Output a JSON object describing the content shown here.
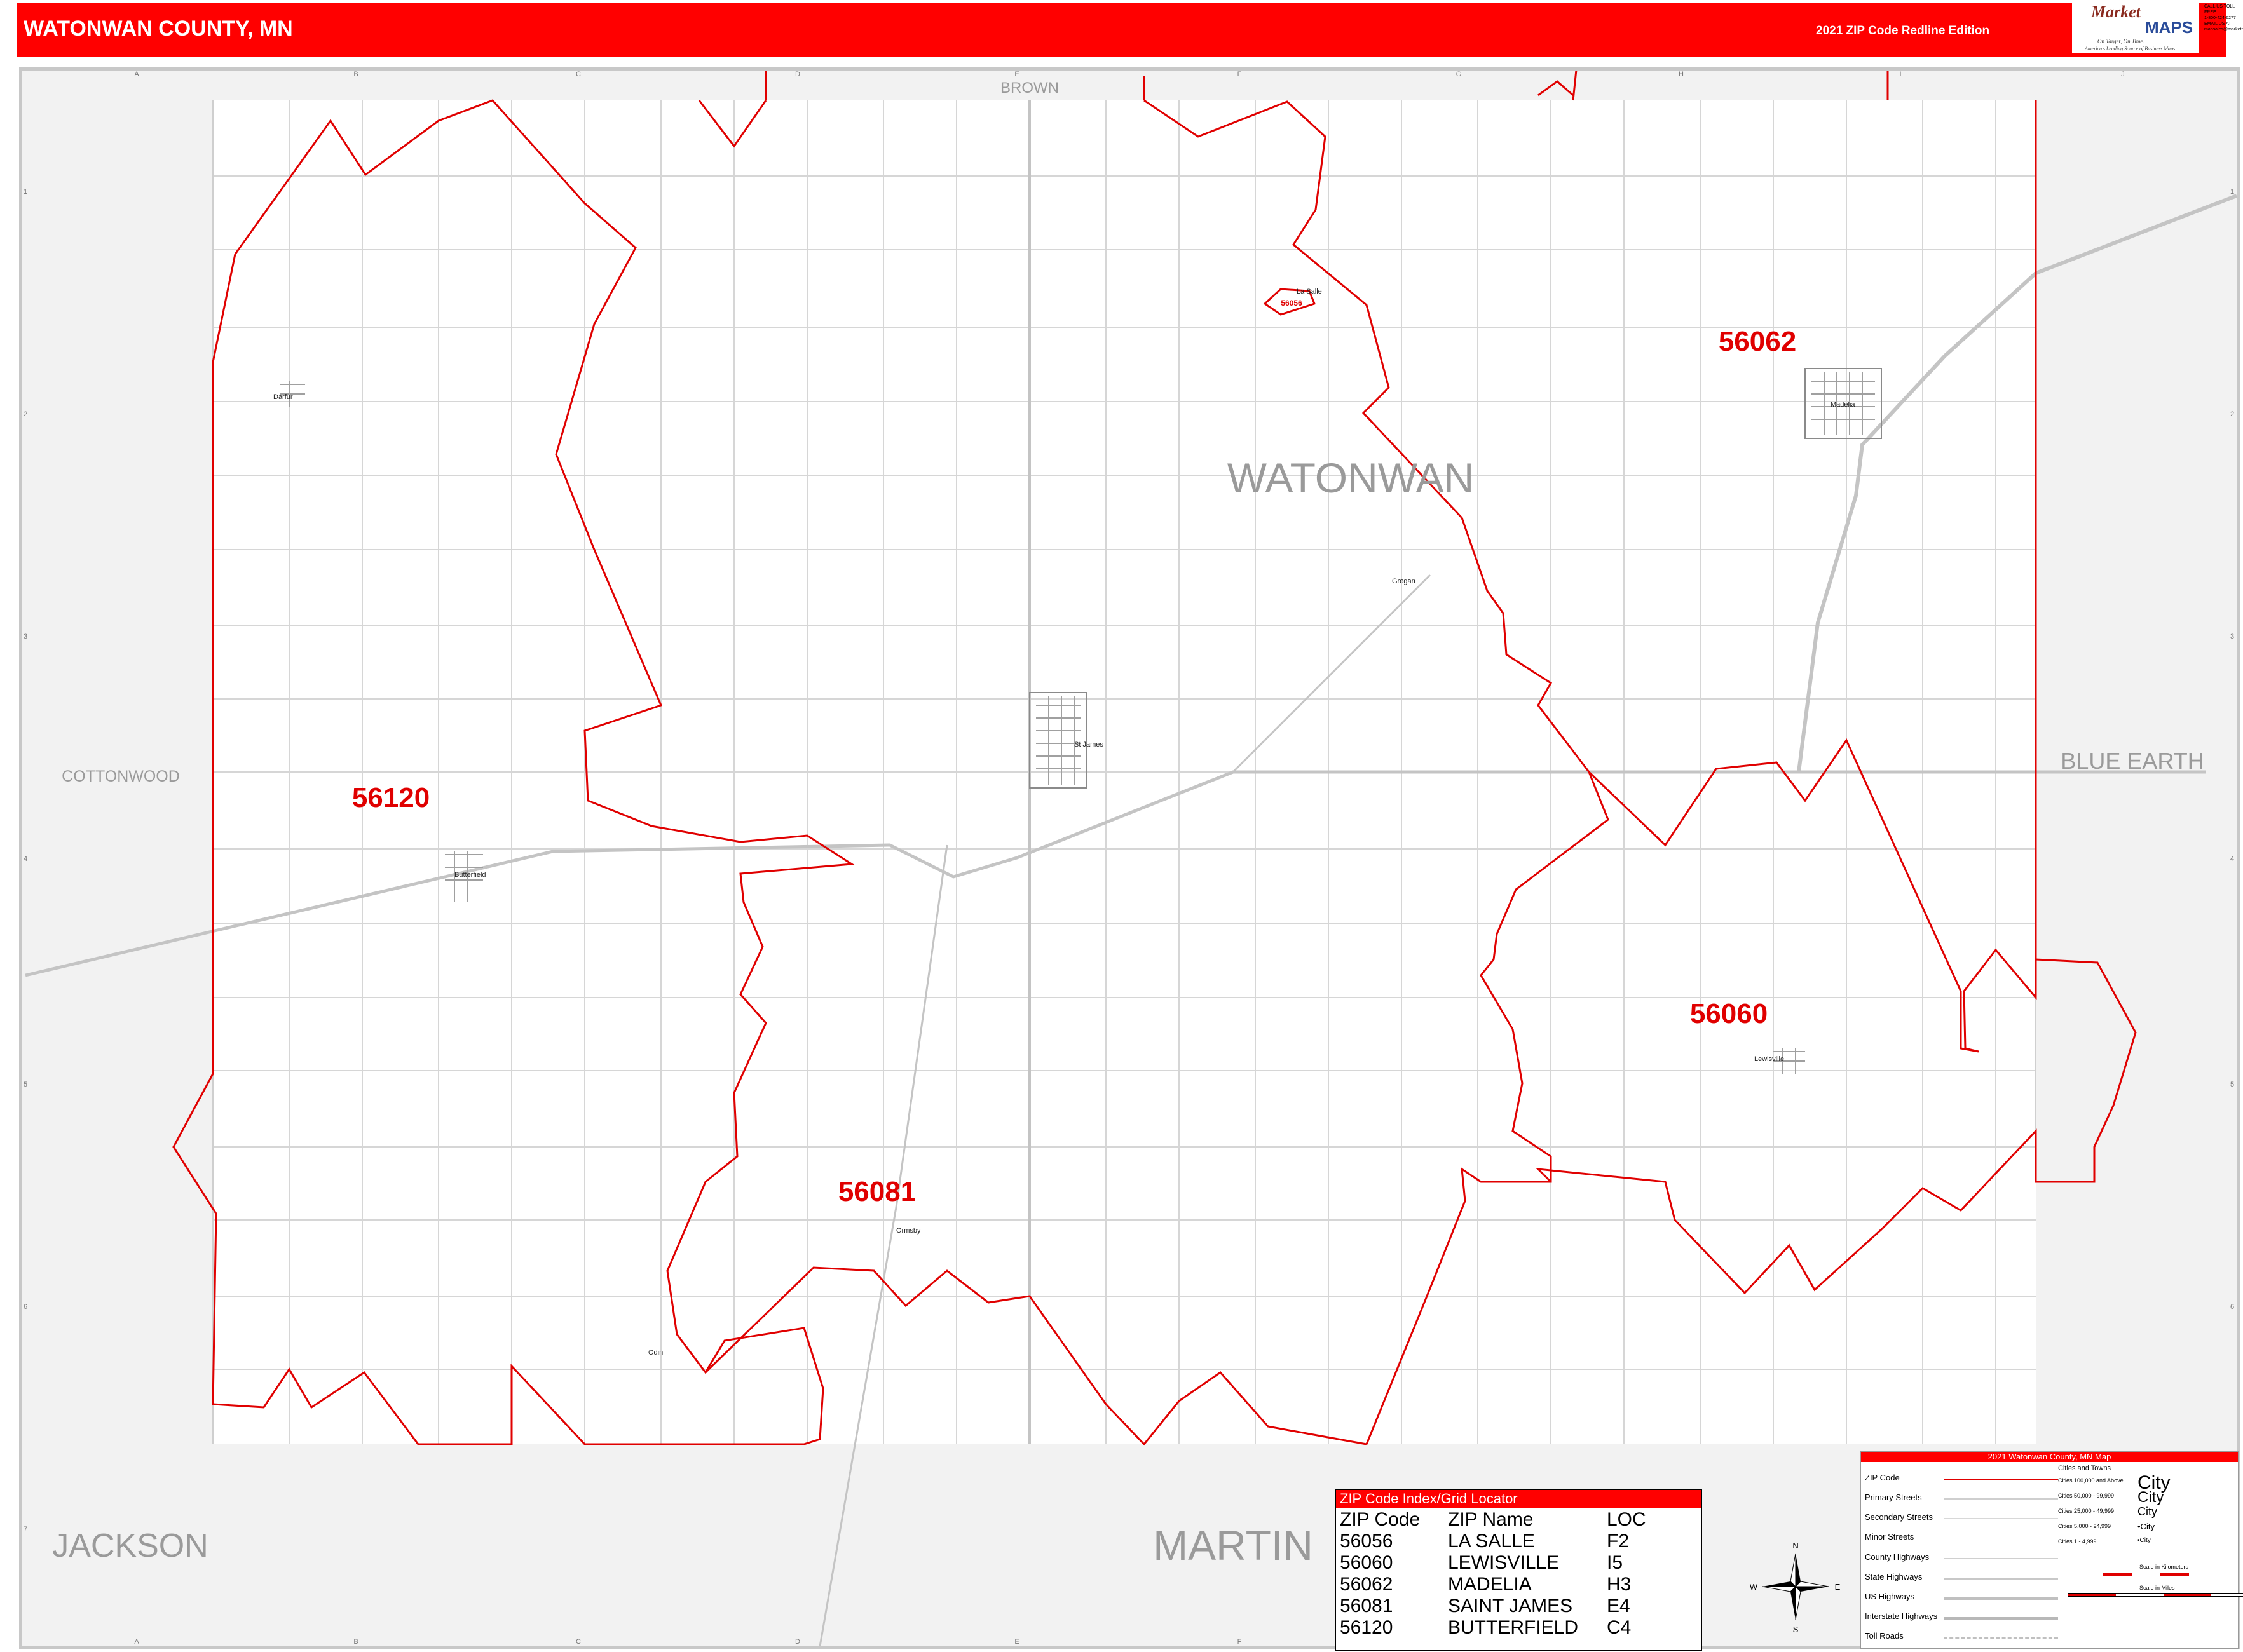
{
  "header": {
    "title": "WATONWAN COUNTY, MN",
    "edition": "2021 ZIP Code Redline Edition",
    "logo_market": "Market",
    "logo_maps": "MAPS",
    "logo_tagline": "On Target, On Time.",
    "logo_subtag": "America's Leading Source of Business Maps",
    "contact": [
      "CALL US TOLL FREE",
      "1-800-424-6277",
      "EMAIL US AT",
      "mapsales@marketmaps.com"
    ]
  },
  "colors": {
    "header": "#ff0000",
    "boundary": "#e00000",
    "zip_label": "#e00000",
    "road": "#c8c8c8",
    "outside": "#f2f2f2"
  },
  "grid": {
    "columns": [
      "A",
      "B",
      "C",
      "D",
      "E",
      "F",
      "G",
      "H",
      "I",
      "J"
    ],
    "rows": [
      "1",
      "2",
      "3",
      "4",
      "5",
      "6",
      "7"
    ]
  },
  "map": {
    "county_name": "WATONWAN",
    "neighbors": {
      "north": "BROWN",
      "west": "COTTONWOOD",
      "east": "BLUE EARTH",
      "southwest": "JACKSON",
      "south": "MARTIN"
    },
    "zip_labels": [
      "56120",
      "56062",
      "56060",
      "56081",
      "56056"
    ],
    "cities": [
      "Darfur",
      "La Salle",
      "Madelia",
      "Odin",
      "St James",
      "Butterfield",
      "Lewisville",
      "Ormsby",
      "Grogan"
    ]
  },
  "index": {
    "title": "ZIP Code Index/Grid Locator",
    "headers": [
      "ZIP Code",
      "ZIP Name",
      "LOC"
    ],
    "rows": [
      [
        "56056",
        "LA SALLE",
        "F2"
      ],
      [
        "56060",
        "LEWISVILLE",
        "I5"
      ],
      [
        "56062",
        "MADELIA",
        "H3"
      ],
      [
        "56081",
        "SAINT JAMES",
        "E4"
      ],
      [
        "56120",
        "BUTTERFIELD",
        "C4"
      ]
    ]
  },
  "legend": {
    "title": "2021 Watonwan County, MN Map",
    "items": [
      "ZIP Code",
      "Primary Streets",
      "Secondary Streets",
      "Minor Streets",
      "County Highways",
      "State Highways",
      "US Highways",
      "Interstate Highways",
      "Toll Roads"
    ],
    "cities_title": "Cities and Towns",
    "cities_classes": [
      "Cities 100,000 and Above",
      "Cities 50,000 - 99,999",
      "Cities 25,000 - 49,999",
      "Cities 5,000 - 24,999",
      "Cities 1 - 4,999"
    ],
    "city_samples": [
      "City",
      "City",
      "City",
      "•City",
      "•City"
    ],
    "scale_km": "Scale in Kilometers",
    "scale_mi": "Scale in Miles"
  },
  "compass": {
    "n": "N",
    "s": "S",
    "e": "E",
    "w": "W"
  }
}
